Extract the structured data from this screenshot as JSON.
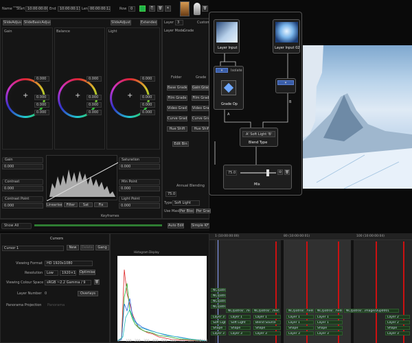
{
  "toolbar": {
    "name_label": "Name",
    "start_label": "Start",
    "start_value": "10:00:00:00",
    "end_label": "End",
    "end_value": "10:00:00:11",
    "len_label": "Len",
    "len_value": "00:00:00:12",
    "row_label": "Row",
    "row_value": "0"
  },
  "color_panel": {
    "tabs": [
      "SlideAdjust",
      "SlideBasicAdjust",
      "SlideAdjust",
      "Extended"
    ],
    "wheel_labels": [
      "Gain",
      "Balance",
      "Light"
    ],
    "wheel_values": [
      [
        "0.000",
        "0.000",
        "0.000",
        "0.000"
      ],
      [
        "0.000",
        "0.000",
        "0.000",
        "0.000"
      ],
      [
        "0.000",
        "0.000",
        "0.000",
        "0.000"
      ]
    ],
    "left_params": [
      {
        "label": "Gain",
        "value": "0.000"
      },
      {
        "label": "Contrast",
        "value": "0.000"
      },
      {
        "label": "Contrast Point",
        "value": "0.000"
      }
    ],
    "right_params": [
      {
        "label": "Saturation",
        "value": "0.000"
      },
      {
        "label": "Min Point",
        "value": "0.000"
      },
      {
        "label": "Light Point",
        "value": "0.000"
      }
    ],
    "curve_buttons": [
      "Linearise",
      "Filter",
      "Sat",
      "Fix"
    ],
    "keyframes_label": "Keyframes",
    "show_label": "Show All",
    "auto_edit": "Auto Edit",
    "simple_kfs": "Simple KFs"
  },
  "layer_panel": {
    "layer_label": "Layer",
    "layer_value": "3",
    "layer_mode_label": "Layer Mode",
    "layer_mode_value": "Grade",
    "custom_label": "Custom",
    "grid_headers": [
      "Folder",
      "Grade"
    ],
    "grid_items": [
      [
        "Base Grade",
        "Gain Grade"
      ],
      [
        "Film Grade",
        "Film Grade"
      ],
      [
        "Video Grade",
        "Video Grade"
      ],
      [
        "Curve Grade",
        "Curve Grade"
      ],
      [
        "Hue Shift",
        "Hue Shift"
      ]
    ],
    "edit_btn": "Edit Bin",
    "annual_blending": "Annual Blending",
    "blend_value": "75.0",
    "type_label": "Type",
    "type_value": "Soft Light",
    "use_mask": "Use Masks",
    "per_block": "Per Block",
    "per_grade": "Per Grade"
  },
  "node_graph": {
    "node_layer_input": "Layer Input",
    "node_layer_input_2": "Layer Input 02",
    "node_grade_op": "Grade Op",
    "isolate_label": "Isolate",
    "blend_op_value": "A' Soft Light 'B'",
    "blend_type_label": "Blend Type",
    "mix_value": "75.0",
    "mix_label": "Mix",
    "port_a": "A",
    "port_b": "B"
  },
  "cursors_panel": {
    "title": "Cursors",
    "cursor_value": "Cursor 1",
    "new_btn": "New",
    "delete_btn": "Delete",
    "gang_btn": "Gang",
    "viewing_format_label": "Viewing Format",
    "viewing_format_value": "HD 1920x1080",
    "resolution_label": "Resolution",
    "resolution_value": "Low",
    "resolution_size": "1920×1080",
    "optimise": "Optimise",
    "colour_space_label": "Viewing Colour Space",
    "colour_space_value": "sRGB ~2.2 Gamma / 9",
    "layer_number_label": "Layer Number",
    "layer_number_value": "0",
    "overlays_btn": "Overlays",
    "panorama_label": "Panorama Projection",
    "panorama_value": "Panorama"
  },
  "histogram": {
    "title": "Histogram Display",
    "x_ticks": [
      "0",
      "100",
      "200",
      "300",
      "400",
      "500",
      "600",
      "700",
      "800",
      "900",
      "1000"
    ]
  },
  "timeline": {
    "ticks": [
      "1 (10:00:00:00)",
      "80 (10:00:00:01)",
      "100 (10:00:00:04)"
    ],
    "clip_label": "NC/patrol",
    "clips": [
      "NC/patrol/...med/...",
      "NC/patrol/...med/...",
      "NC/patrol/...hedge/...",
      "NC/patrol/...hedge/...",
      "NC/patrol/...image/Dup0001"
    ],
    "layer_rows": [
      [
        "Layer 1",
        "Layer 1",
        "Layer 1",
        "Layer 1",
        "Layer 2"
      ],
      [
        "Soft Light",
        "Blend Source",
        "Layer 1",
        "Layer 1",
        "Layer 2"
      ],
      [
        "Shape",
        "Shape",
        "Shape",
        "Shape",
        "Shape"
      ],
      [
        "Layer 3",
        "Layer 3",
        "Layer 3",
        "Layer 3",
        "Layer 3"
      ]
    ],
    "row_heads": [
      "Layer 3",
      "Soft Light",
      "Shape",
      "Layer 3"
    ]
  },
  "colors": {
    "accent_green": "#2e7d32",
    "record_green": "#1fb34a",
    "playhead_red": "#cc1111",
    "panel_bg": "#151515"
  }
}
